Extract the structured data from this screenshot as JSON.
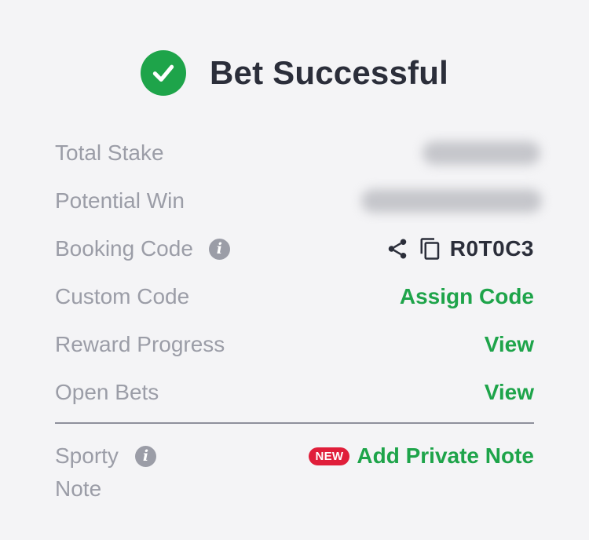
{
  "colors": {
    "success": "#1ea44a",
    "badge": "#e01e3a"
  },
  "header": {
    "icon": "check-circle-icon",
    "title": "Bet Successful"
  },
  "rows": {
    "total_stake": {
      "label": "Total Stake"
    },
    "potential_win": {
      "label": "Potential Win"
    },
    "booking_code": {
      "label": "Booking Code",
      "code": "R0T0C3",
      "share_icon": "share-icon",
      "copy_icon": "copy-icon",
      "info_icon": "info-icon"
    },
    "custom_code": {
      "label": "Custom Code",
      "action": "Assign Code"
    },
    "reward_progress": {
      "label": "Reward Progress",
      "action": "View"
    },
    "open_bets": {
      "label": "Open Bets",
      "action": "View"
    }
  },
  "note": {
    "label_line1": "Sporty",
    "label_line2": "Note",
    "badge": "NEW",
    "action": "Add Private Note",
    "info_icon": "info-icon"
  }
}
